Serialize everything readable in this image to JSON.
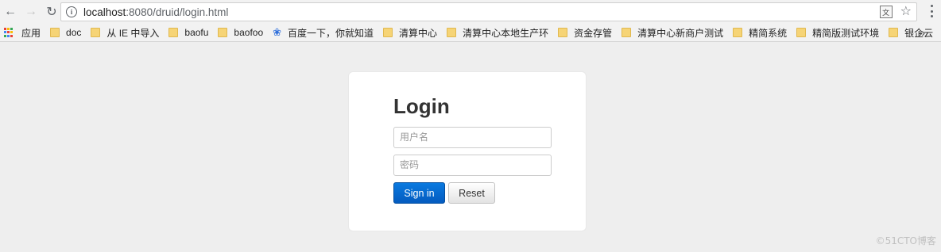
{
  "browser": {
    "url_host": "localhost",
    "url_path": ":8080/druid/login.html",
    "icons": {
      "back": "arrow-left",
      "forward": "arrow-right",
      "reload": "reload",
      "info": "info",
      "translate": "translate",
      "star": "star",
      "menu": "more-vertical"
    }
  },
  "bookmarks": {
    "apps_label": "应用",
    "items": [
      {
        "label": "doc",
        "icon": "folder"
      },
      {
        "label": "从 IE 中导入",
        "icon": "folder"
      },
      {
        "label": "baofu",
        "icon": "folder"
      },
      {
        "label": "baofoo",
        "icon": "folder"
      },
      {
        "label": "百度一下，你就知道",
        "icon": "paw"
      },
      {
        "label": "清算中心",
        "icon": "folder"
      },
      {
        "label": "清算中心本地生产环",
        "icon": "folder"
      },
      {
        "label": "资金存管",
        "icon": "folder"
      },
      {
        "label": "清算中心新商户测试",
        "icon": "folder"
      },
      {
        "label": "精简系统",
        "icon": "folder"
      },
      {
        "label": "精简版测试环境",
        "icon": "folder"
      },
      {
        "label": "银企云",
        "icon": "folder"
      }
    ],
    "overflow": "»"
  },
  "login": {
    "title": "Login",
    "username_placeholder": "用户名",
    "password_placeholder": "密码",
    "signin_label": "Sign in",
    "reset_label": "Reset"
  },
  "watermark": "©51CTO博客",
  "colors": {
    "primary_button": "#0a6fd6",
    "page_bg": "#eeeeee",
    "card_bg": "#ffffff"
  }
}
